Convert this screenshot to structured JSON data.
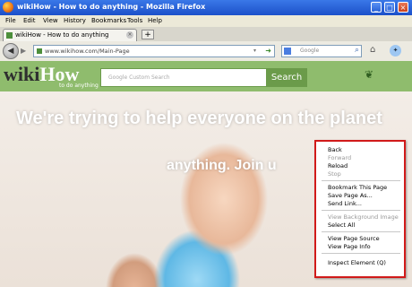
{
  "window": {
    "title": "wikiHow - How to do anything - Mozilla Firefox",
    "controls": [
      "_",
      "□",
      "×"
    ]
  },
  "menubar": [
    "File",
    "Edit",
    "View",
    "History",
    "Bookmarks",
    "Tools",
    "Help"
  ],
  "tabs": [
    {
      "title": "wikiHow - How to do anything"
    }
  ],
  "new_tab_label": "+",
  "navbar": {
    "url": "www.wikihow.com/Main-Page",
    "search_placeholder": "Google"
  },
  "site": {
    "logo_wiki": "wiki",
    "logo_how": "How",
    "tagline": "to do anything",
    "search_placeholder": "Google Custom Search",
    "search_button": "Search",
    "headline": "We're trying to help everyone on the planet",
    "headline_2": "anything. Join u"
  },
  "context_menu": {
    "items": [
      {
        "label": "Back",
        "enabled": true
      },
      {
        "label": "Forward",
        "enabled": false
      },
      {
        "label": "Reload",
        "enabled": true
      },
      {
        "label": "Stop",
        "enabled": false
      },
      {
        "label": "Bookmark This Page",
        "enabled": true
      },
      {
        "label": "Save Page As...",
        "enabled": true
      },
      {
        "label": "Send Link...",
        "enabled": true
      },
      {
        "label": "View Background Image",
        "enabled": false
      },
      {
        "label": "Select All",
        "enabled": true
      },
      {
        "label": "View Page Source",
        "enabled": true
      },
      {
        "label": "View Page Info",
        "enabled": true
      },
      {
        "label": "Inspect Element (Q)",
        "enabled": true
      }
    ],
    "highlight_color": "#d11a1a"
  },
  "colors": {
    "site_header": "#8fbc6d",
    "title_bar": "#2a62d6"
  }
}
